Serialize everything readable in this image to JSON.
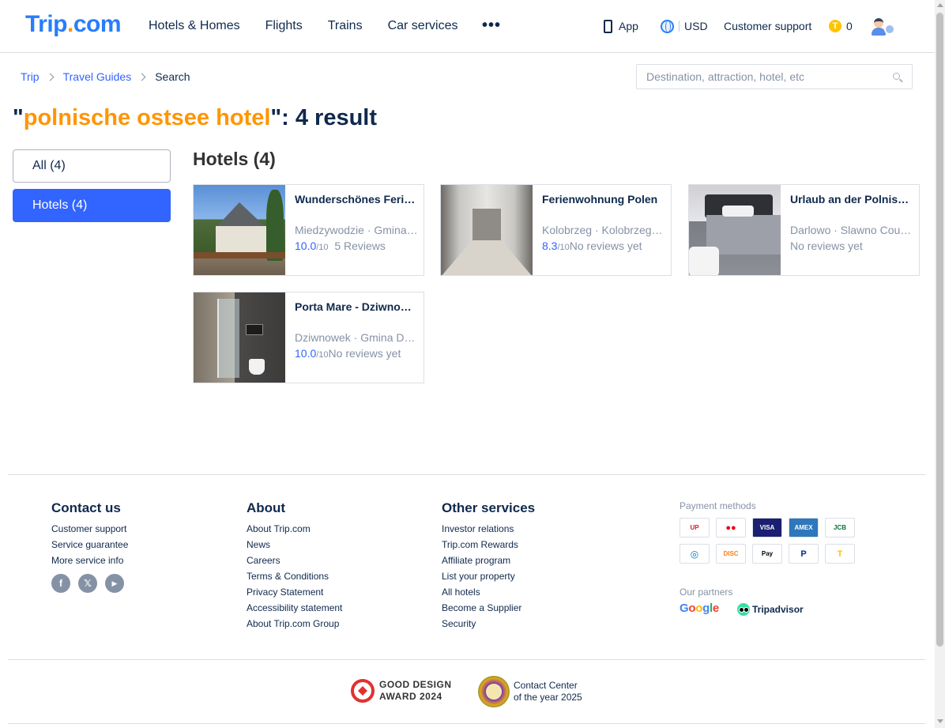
{
  "header": {
    "logo_main": "Trip",
    "logo_dot": ".",
    "logo_tail": "com",
    "nav": [
      "Hotels & Homes",
      "Flights",
      "Trains",
      "Car services"
    ],
    "more": "•••",
    "app_label": "App",
    "currency": "USD",
    "customer_support": "Customer support",
    "coin_symbol": "T",
    "coins": "0"
  },
  "breadcrumb": {
    "items": [
      "Trip",
      "Travel Guides"
    ],
    "current": "Search"
  },
  "search": {
    "placeholder": "Destination, attraction, hotel, etc"
  },
  "results": {
    "quote_open": "\"",
    "keyword": "polnische ostsee hotel",
    "suffix": "\": 4 result"
  },
  "filters": {
    "all": "All (4)",
    "hotels": "Hotels (4)",
    "active": "hotels"
  },
  "section_title": "Hotels (4)",
  "hotels": [
    {
      "name": "Wunderschönes Ferienhaus",
      "location": "Miedzywodzie · Gmina Dziwnow",
      "score": "10.0",
      "outof": "/10",
      "reviews": "5 Reviews"
    },
    {
      "name": "Ferienwohnung Polen",
      "location": "Kolobrzeg · Kolobrzeg County",
      "score": "8.3",
      "outof": "/10",
      "reviews": "No reviews yet"
    },
    {
      "name": "Urlaub an der Polnischen Ostsee",
      "location": "Darlowo · Slawno County",
      "score": "",
      "outof": "",
      "reviews": "No reviews yet"
    },
    {
      "name": "Porta Mare - Dziwnowek",
      "location": "Dziwnowek · Gmina Dziwnow",
      "score": "10.0",
      "outof": "/10",
      "reviews": "No reviews yet"
    }
  ],
  "footer": {
    "contact": {
      "title": "Contact us",
      "links": [
        "Customer support",
        "Service guarantee",
        "More service info"
      ],
      "social": [
        "f",
        "𝕏",
        "▶"
      ]
    },
    "about": {
      "title": "About",
      "links": [
        "About Trip.com",
        "News",
        "Careers",
        "Terms & Conditions",
        "Privacy Statement",
        "Accessibility statement",
        "About Trip.com Group"
      ]
    },
    "other": {
      "title": "Other services",
      "links": [
        "Investor relations",
        "Trip.com Rewards",
        "Affiliate program",
        "List your property",
        "All hotels",
        "Become a Supplier",
        "Security"
      ]
    },
    "payment_title": "Payment methods",
    "payments": [
      {
        "icon": "unionpay-icon",
        "text": "UP",
        "color": "#d7182a"
      },
      {
        "icon": "mastercard-icon",
        "text": "●●",
        "color": "#eb001b"
      },
      {
        "icon": "visa-icon",
        "text": "VISA",
        "color": "#1a1f71"
      },
      {
        "icon": "amex-icon",
        "text": "AMEX",
        "color": "#2e77bb"
      },
      {
        "icon": "jcb-icon",
        "text": "JCB",
        "color": "#0b6e3f"
      },
      {
        "icon": "diners-icon",
        "text": "◎",
        "color": "#0079be"
      },
      {
        "icon": "discover-icon",
        "text": "DISC",
        "color": "#f58220"
      },
      {
        "icon": "applepay-icon",
        "text": "Pay",
        "color": "#000000"
      },
      {
        "icon": "paypal-icon",
        "text": "P",
        "color": "#003087"
      },
      {
        "icon": "tripcoins-icon",
        "text": "T",
        "color": "#ffc400"
      }
    ],
    "partners_title": "Our partners",
    "partner_google": [
      "G",
      "o",
      "o",
      "g",
      "l",
      "e"
    ],
    "partner_tripadvisor": "Tripadvisor",
    "award_gd_line1": "GOOD DESIGN",
    "award_gd_line2": "AWARD 2024",
    "award_cc_line1": "Contact Center",
    "award_cc_line2": "of the year 2025"
  },
  "colors": {
    "brand_blue": "#287dfa",
    "brand_orange": "#ff9500",
    "active_filter": "#3264ff",
    "text_dark": "#0f294d"
  }
}
